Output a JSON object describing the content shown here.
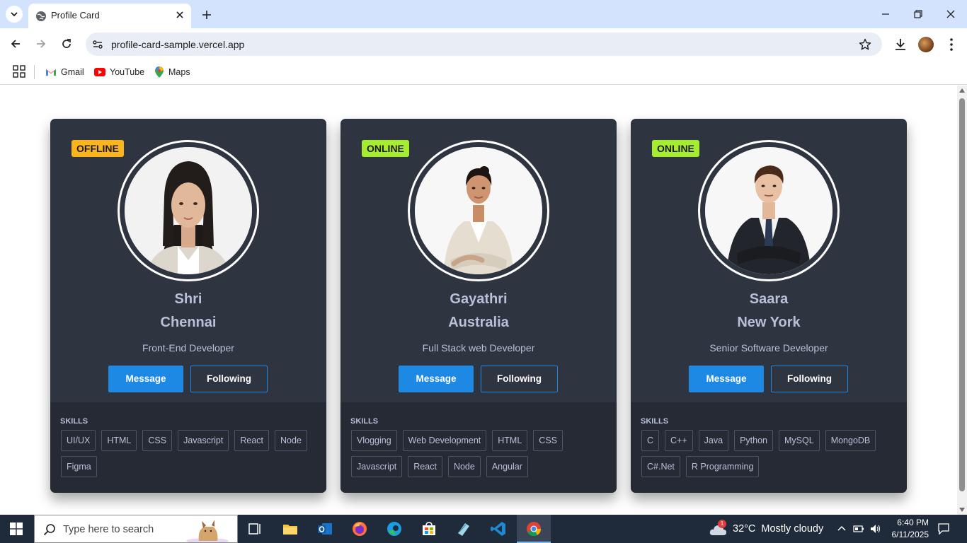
{
  "browser": {
    "tab_title": "Profile Card",
    "url": "profile-card-sample.vercel.app",
    "bookmarks": [
      {
        "label": "Gmail",
        "icon": "gmail-icon"
      },
      {
        "label": "YouTube",
        "icon": "youtube-icon"
      },
      {
        "label": "Maps",
        "icon": "maps-icon"
      }
    ]
  },
  "page": {
    "skills_title": "SKILLS",
    "message_label": "Message",
    "following_label": "Following",
    "colors": {
      "card_bg": "#2f3441",
      "skills_bg": "#262a35",
      "accent": "#1e88e5",
      "offline": "#fbb51c",
      "online": "#a6ed32"
    }
  },
  "cards": [
    {
      "status": "OFFLINE",
      "name": "Shri",
      "location": "Chennai",
      "role": "Front-End Developer",
      "skills": [
        "UI/UX",
        "HTML",
        "CSS",
        "Javascript",
        "React",
        "Node",
        "Figma"
      ]
    },
    {
      "status": "ONLINE",
      "name": "Gayathri",
      "location": "Australia",
      "role": "Full Stack web Developer",
      "skills": [
        "Vlogging",
        "Web Development",
        "HTML",
        "CSS",
        "Javascript",
        "React",
        "Node",
        "Angular"
      ]
    },
    {
      "status": "ONLINE",
      "name": "Saara",
      "location": "New York",
      "role": "Senior Software Developer",
      "skills": [
        "C",
        "C++",
        "Java",
        "Python",
        "MySQL",
        "MongoDB",
        "C#.Net",
        "R Programming"
      ]
    }
  ],
  "taskbar": {
    "search_placeholder": "Type here to search",
    "weather_temp": "32°C",
    "weather_text": "Mostly cloudy",
    "weather_alert_count": "1",
    "time": "6:40 PM",
    "date": "6/11/2025",
    "pinned_apps": [
      "task-view-icon",
      "file-explorer-icon",
      "outlook-icon",
      "firefox-icon",
      "edge-icon",
      "store-icon",
      "notepad-icon",
      "vscode-icon",
      "chrome-icon"
    ]
  }
}
